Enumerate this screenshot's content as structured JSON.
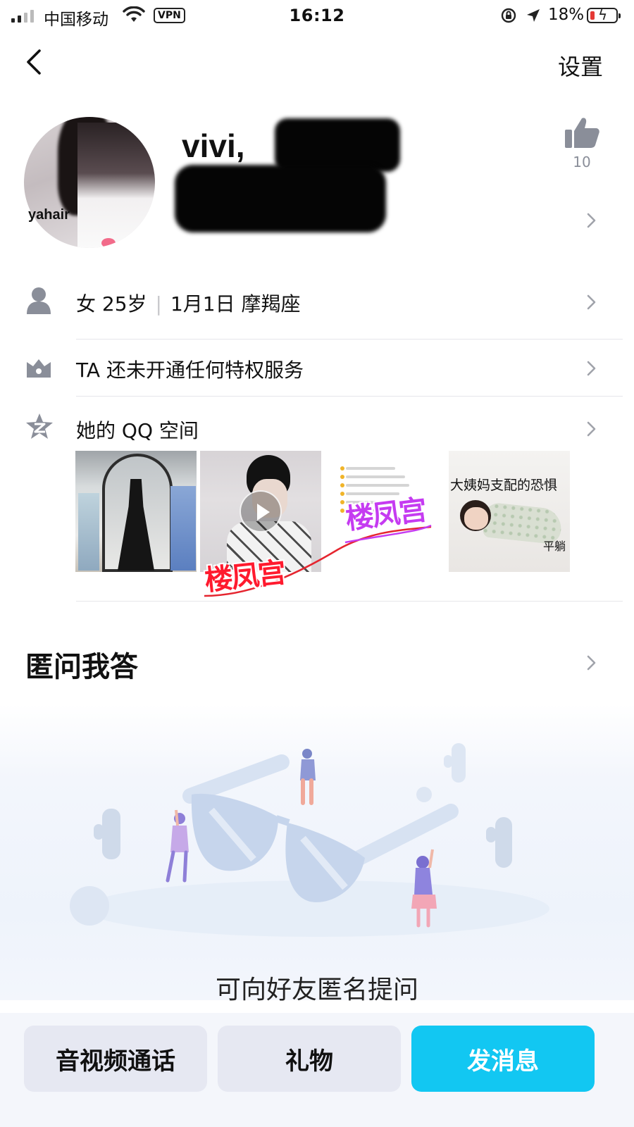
{
  "status_bar": {
    "carrier": "中国移动",
    "vpn": "VPN",
    "time": "16:12",
    "battery_pct": "18%",
    "battery_level": 0.18,
    "signal_bars": 2
  },
  "nav": {
    "back_icon": "chevron-left-icon",
    "settings_label": "设置"
  },
  "profile": {
    "avatar_caption": "yahair",
    "nickname": "vivi,",
    "like_count": "10",
    "like_icon": "thumbs-up-icon"
  },
  "info_rows": [
    {
      "icon": "person-icon",
      "gender_age": "女 25岁",
      "birthday": "1月1日 摩羯座"
    },
    {
      "icon": "crown-icon",
      "text": "TA 还未开通任何特权服务"
    },
    {
      "icon": "qzone-star-icon",
      "text": "她的 QQ 空间"
    }
  ],
  "qzone_thumbs": [
    {
      "kind": "photo",
      "name": "dress-photo"
    },
    {
      "kind": "video",
      "name": "video-thumb"
    },
    {
      "kind": "image",
      "name": "chat-screenshot"
    },
    {
      "kind": "image",
      "name": "meme",
      "caption_top": "大姨妈支配的恐惧",
      "caption_bottom": "平躺"
    }
  ],
  "watermarks": [
    "楼凤宫",
    "楼凤宫"
  ],
  "qa": {
    "title": "匿问我答",
    "hint": "可向好友匿名提问"
  },
  "actions": {
    "call_label": "音视频通话",
    "gift_label": "礼物",
    "message_label": "发消息"
  },
  "colors": {
    "accent": "#12c7f2",
    "battery_low": "#e53935",
    "watermark_red": "#ff1a2e",
    "watermark_purple": "#c53bf1",
    "icon_grey": "#8a8e99"
  }
}
